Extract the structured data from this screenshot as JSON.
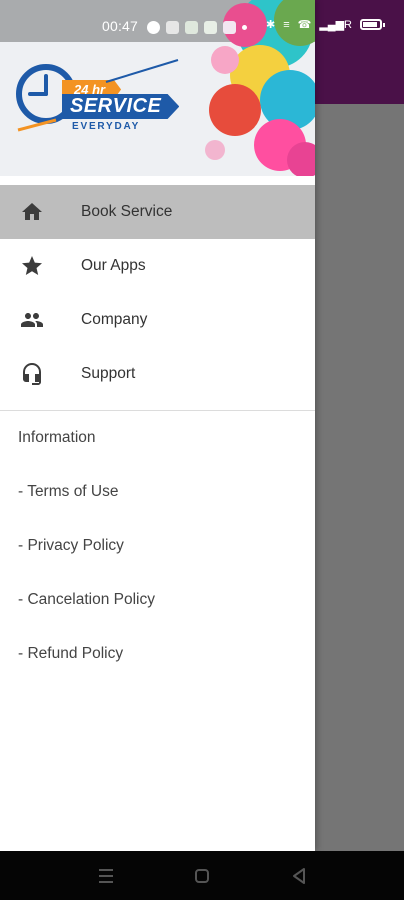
{
  "status_bar": {
    "time": "00:47",
    "signal_text": "R"
  },
  "drawer": {
    "header": {
      "logo": {
        "badge": "24 hr",
        "main": "SERVICE",
        "tagline": "EVERYDAY"
      }
    },
    "menu": [
      {
        "label": "Book Service",
        "icon": "home-icon",
        "active": true
      },
      {
        "label": "Our Apps",
        "icon": "star-icon",
        "active": false
      },
      {
        "label": "Company",
        "icon": "people-icon",
        "active": false
      },
      {
        "label": "Support",
        "icon": "headset-icon",
        "active": false
      }
    ],
    "info": {
      "heading": "Information",
      "items": [
        "- Terms of Use",
        "- Privacy Policy",
        "- Cancelation Policy",
        "- Refund Policy"
      ]
    }
  },
  "colors": {
    "app_bar": "#4a1148",
    "scrim": "#757575",
    "active_item_bg": "#bdbdbd",
    "logo_blue": "#1e5aa8",
    "logo_orange": "#f39323"
  }
}
